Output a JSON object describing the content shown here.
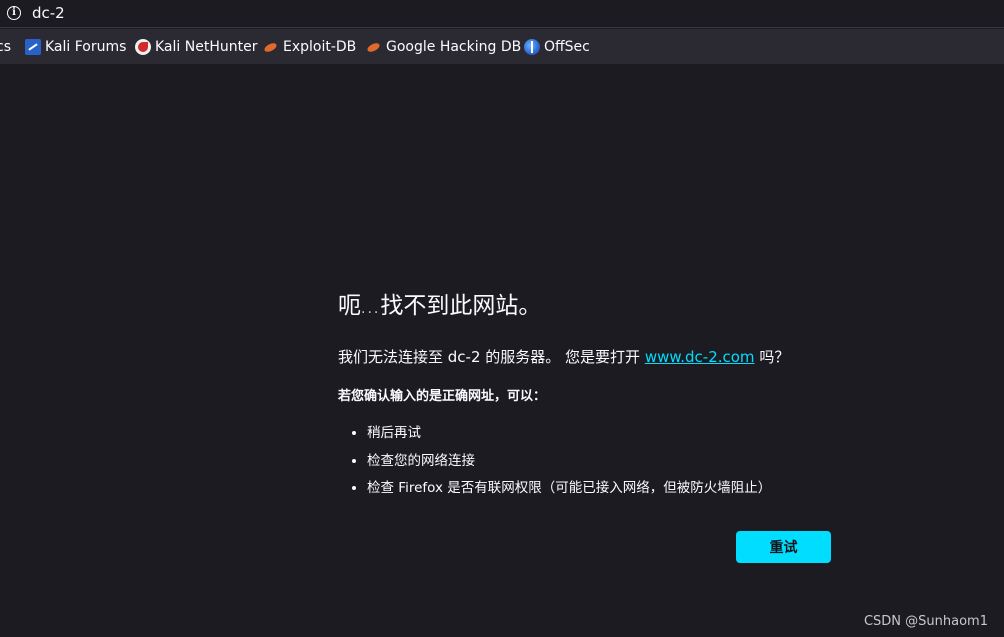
{
  "urlbar": {
    "info_icon": "info-icon",
    "url": "dc-2"
  },
  "bookmarks": [
    {
      "label": "cs",
      "icon": "none"
    },
    {
      "label": "Kali Forums",
      "icon": "kali-icon"
    },
    {
      "label": "Kali NetHunter",
      "icon": "nethunter-icon"
    },
    {
      "label": "Exploit-DB",
      "icon": "exploitdb-icon"
    },
    {
      "label": "Google Hacking DB",
      "icon": "exploitdb-icon"
    },
    {
      "label": "OffSec",
      "icon": "offsec-icon"
    }
  ],
  "error": {
    "title_prefix": "呃",
    "title_dots": "...",
    "title_suffix": "找不到此网站。",
    "desc_prefix": "我们无法连接至 dc-2 的服务器。 您是要打开 ",
    "desc_link": "www.dc-2.com",
    "desc_suffix": " 吗？",
    "hint": "若您确认输入的是正确网址，可以：",
    "suggestions": [
      "稍后再试",
      "检查您的网络连接",
      "检查 Firefox 是否有联网权限（可能已接入网络，但被防火墙阻止）"
    ],
    "retry_label": "重试"
  },
  "watermark": "CSDN @Sunhaom1",
  "colors": {
    "page_bg": "#1c1b22",
    "toolbar_bg": "#2b2a33",
    "accent": "#00ddff",
    "text": "#fbfbfe"
  }
}
